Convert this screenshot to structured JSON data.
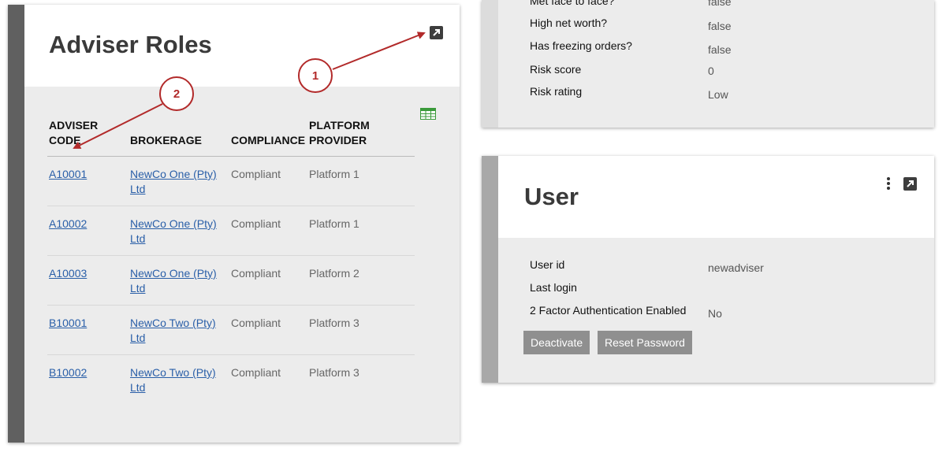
{
  "adviser_roles": {
    "title": "Adviser Roles",
    "columns": {
      "code_line1": "ADVISER",
      "code_line2": "CODE",
      "brokerage": "BROKERAGE",
      "compliance": "COMPLIANCE",
      "platform_line1": "PLATFORM",
      "platform_line2": "PROVIDER"
    },
    "rows": [
      {
        "code": "A10001",
        "brokerage_line1": "NewCo One (Pty)",
        "brokerage_line2": "Ltd",
        "compliance": "Compliant",
        "platform": "Platform 1"
      },
      {
        "code": "A10002",
        "brokerage_line1": "NewCo One (Pty)",
        "brokerage_line2": "Ltd",
        "compliance": "Compliant",
        "platform": "Platform 1"
      },
      {
        "code": "A10003",
        "brokerage_line1": "NewCo One (Pty)",
        "brokerage_line2": "Ltd",
        "compliance": "Compliant",
        "platform": "Platform 2"
      },
      {
        "code": "B10001",
        "brokerage_line1": "NewCo Two (Pty)",
        "brokerage_line2": "Ltd",
        "compliance": "Compliant",
        "platform": "Platform 3"
      },
      {
        "code": "B10002",
        "brokerage_line1": "NewCo Two (Pty)",
        "brokerage_line2": "Ltd",
        "compliance": "Compliant",
        "platform": "Platform 3"
      }
    ],
    "icons": {
      "open": "external-link-icon",
      "export": "spreadsheet-icon"
    }
  },
  "info": {
    "fields": [
      {
        "label": "Met face to face?",
        "value": "false"
      },
      {
        "label": "High net worth?",
        "value": "false"
      },
      {
        "label": "Has freezing orders?",
        "value": "false"
      },
      {
        "label": "Risk score",
        "value": "0"
      },
      {
        "label": "Risk rating",
        "value": "Low"
      }
    ]
  },
  "user": {
    "title": "User",
    "fields": [
      {
        "label": "User id",
        "value": "newadviser"
      },
      {
        "label": "Last login",
        "value": ""
      },
      {
        "label": "2 Factor Authentication Enabled",
        "value": "No"
      }
    ],
    "buttons": {
      "deactivate": "Deactivate",
      "reset_password": "Reset Password"
    },
    "icons": {
      "menu": "kebab-menu-icon",
      "open": "external-link-icon"
    }
  },
  "annotations": {
    "callout_1": "1",
    "callout_2": "2"
  },
  "colors": {
    "annotation": "#b22a2a",
    "link": "#2a5fa8",
    "button": "#8f8f8f"
  }
}
